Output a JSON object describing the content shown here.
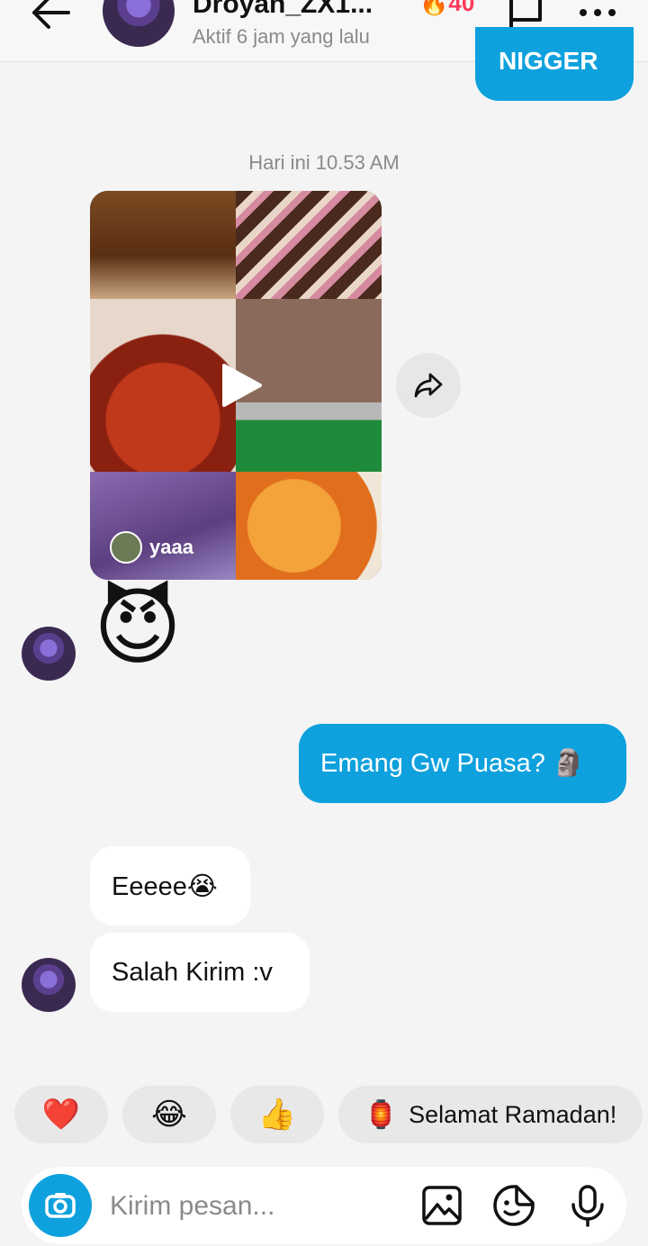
{
  "header": {
    "name": "Droyan_ZX1...",
    "status": "Aktif 6 jam yang lalu",
    "streak": "🔥40"
  },
  "messages": {
    "prev_outgoing": "NIGGER",
    "timestamp": "Hari ini 10.53 AM",
    "video_username": "yaaa",
    "reaction_emoji": "😈",
    "outgoing_1": "Emang Gw Puasa? 🗿",
    "incoming_1": "Eeeee😭",
    "incoming_2": "Salah Kirim :v"
  },
  "quick_replies": [
    "❤️",
    "😂",
    "👍",
    "🏮",
    "Selamat Ramadan!"
  ],
  "composer": {
    "placeholder": "Kirim pesan..."
  },
  "colors": {
    "accent": "#0ea1dd",
    "streak": "#ff3b5c"
  },
  "icons": [
    "back-arrow-icon",
    "flag-icon",
    "more-icon",
    "play-icon",
    "share-icon",
    "camera-icon",
    "gallery-icon",
    "sticker-icon",
    "microphone-icon"
  ]
}
